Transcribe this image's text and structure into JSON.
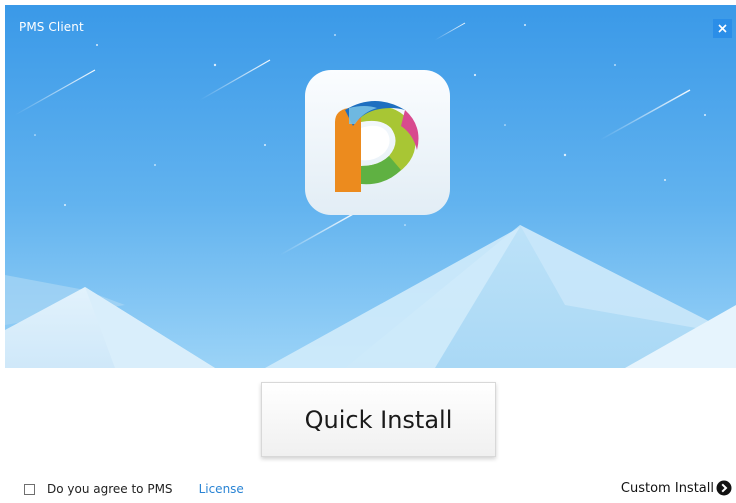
{
  "window": {
    "title": "PMS Client",
    "close_symbol": "×"
  },
  "banner": {
    "sky_top_color": "#3d9ce9",
    "sky_bottom_color": "#8fcdf6",
    "app_logo": "pms-logo-icon"
  },
  "actions": {
    "quick_install_label": "Quick Install",
    "custom_install_label": "Custom Install",
    "custom_install_icon": "arrow-right-circle-icon"
  },
  "agreement": {
    "checked": false,
    "text": "Do you agree to PMS",
    "link_label": "License"
  }
}
